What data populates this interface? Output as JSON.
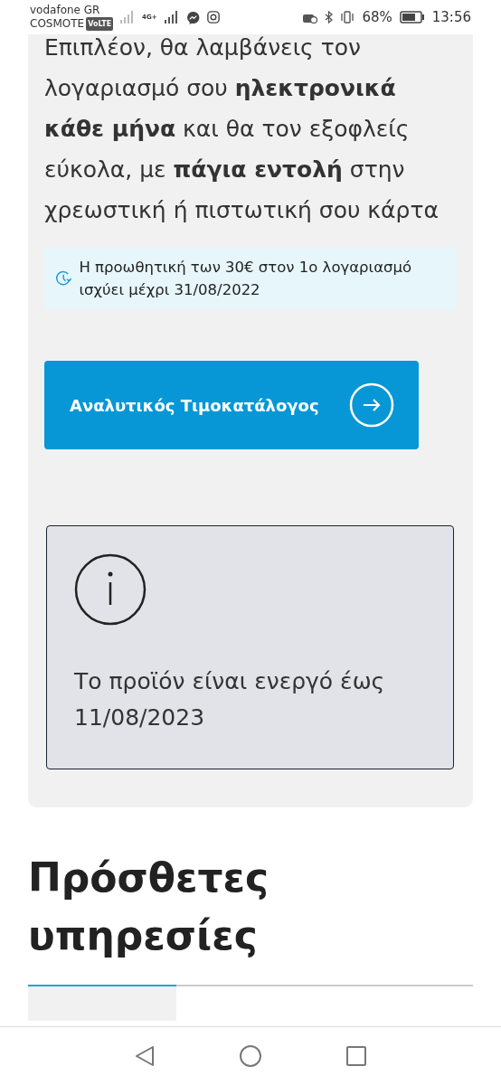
{
  "status_bar": {
    "carrier_1": "vodafone GR",
    "carrier_2": "COSMOTE",
    "volte": "VoLTE",
    "network": "4G+",
    "battery": "68%",
    "time": "13:56"
  },
  "offer_card": {
    "paragraph": "Επιπλέον, θα λαμβάνεις τον λογαριασμό σου **ηλεκτρονικά κάθε μήνα** και θα τον εξοφλείς εύκολα, με **πάγια εντολή** στην χρεωστική ή πιστωτική σου κάρτα",
    "notice": "Η προωθητική των 30€ στον 1ο λογαριασμό ισχύει μέχρι 31/08/2022",
    "button": "Αναλυτικός Τιμοκατάλογος",
    "info": "Το προϊόν είναι ενεργό έως 11/08/2023"
  },
  "section_title": "Πρόσθετες υπηρεσίες",
  "tabs": [
    {
      "selected": true
    },
    {
      "selected": false
    },
    {
      "selected": false
    }
  ]
}
